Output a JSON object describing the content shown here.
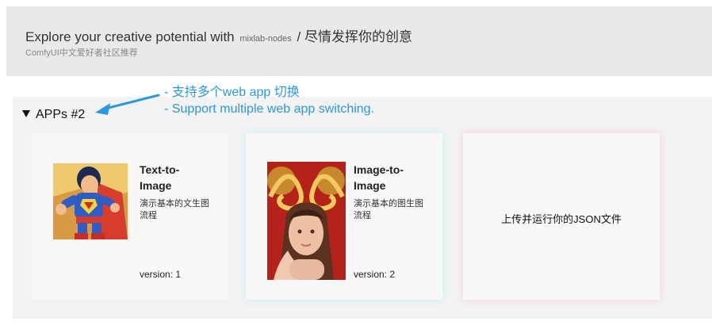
{
  "header": {
    "title_main": "Explore your creative potential with",
    "title_brand": "mixlab-nodes",
    "title_tail": "/ 尽情发挥你的创意",
    "subtitle": "ComfyUI中文爱好者社区推荐"
  },
  "annotation": {
    "line1": "- 支持多个web app 切换",
    "line2": "- Support multiple web app switching.",
    "color": "#2a98de"
  },
  "apps": {
    "summary": "APPs #2",
    "cards": [
      {
        "title": "Text-to-Image",
        "description": "演示基本的文生图流程",
        "version": "version: 1",
        "thumbnail_icon": "superhero-thumbnail"
      },
      {
        "title": "Image-to-Image",
        "description": "演示基本的图生图流程",
        "version": "version: 2",
        "thumbnail_icon": "portrait-thumbnail"
      }
    ],
    "upload_label": "上传并运行你的JSON文件"
  }
}
